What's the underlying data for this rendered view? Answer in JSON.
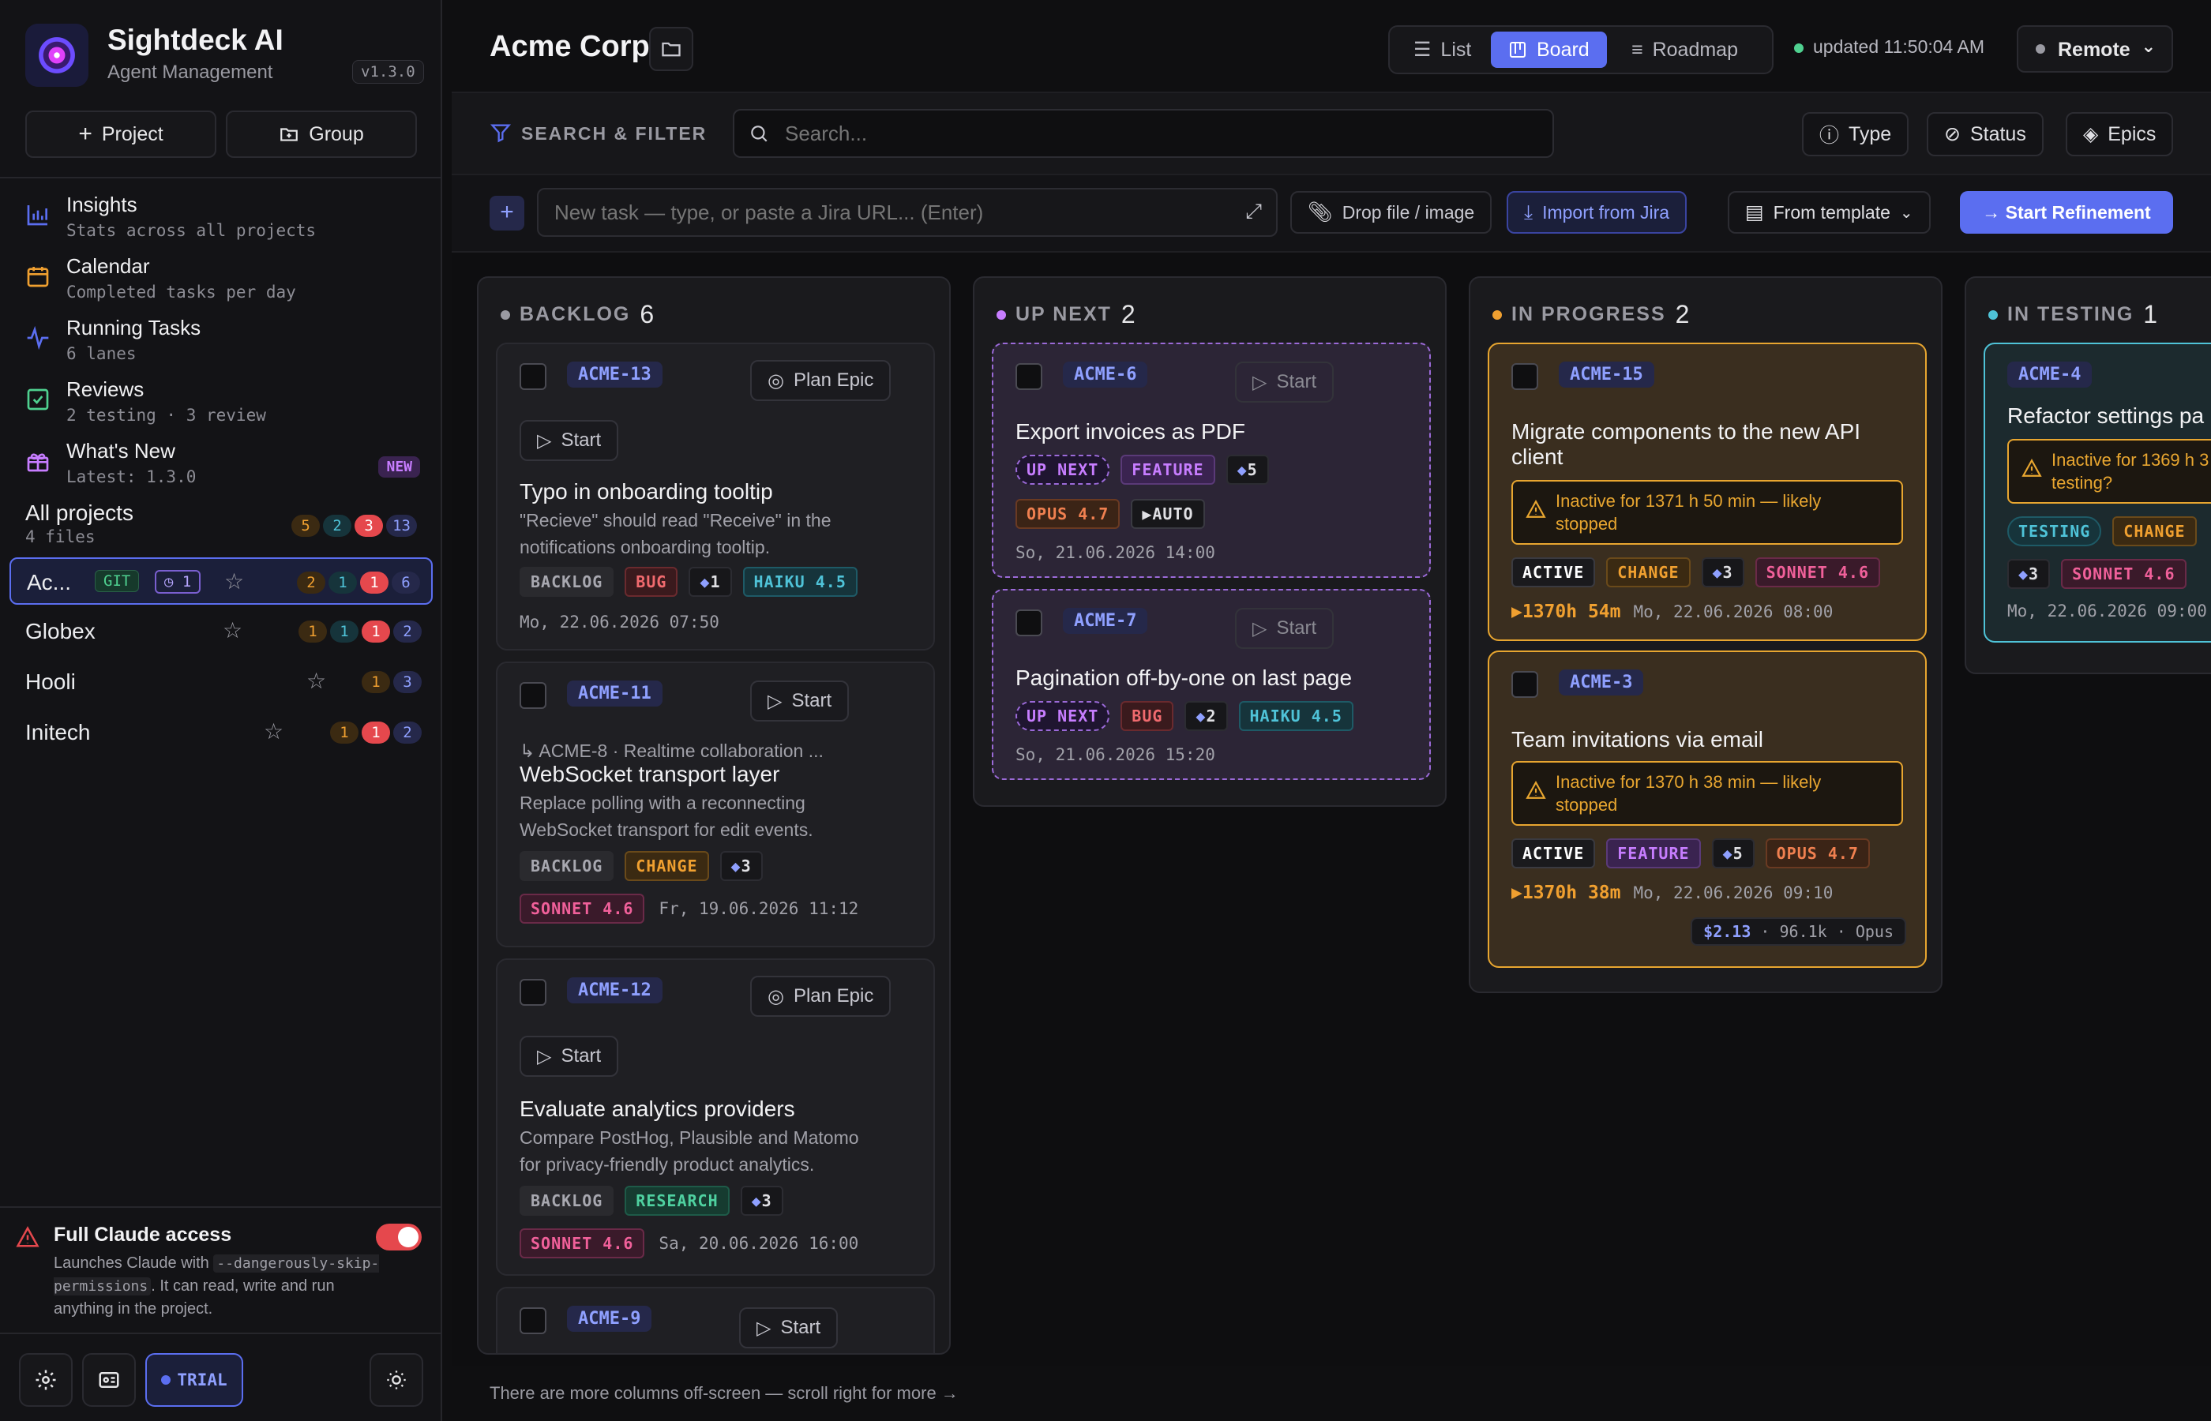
{
  "app": {
    "name": "Sightdeck AI",
    "subtitle": "Agent Management",
    "version": "v1.3.0"
  },
  "sidebar": {
    "add_project": "Project",
    "add_group": "Group",
    "nav": [
      {
        "title": "Insights",
        "sub": "Stats across all projects",
        "icon": "bar-chart-icon"
      },
      {
        "title": "Calendar",
        "sub": "Completed tasks per day",
        "icon": "calendar-icon"
      },
      {
        "title": "Running Tasks",
        "sub": "6 lanes",
        "icon": "activity-icon"
      },
      {
        "title": "Reviews",
        "sub": "2 testing · 3 review",
        "icon": "check-square-icon"
      },
      {
        "title": "What's New",
        "sub": "Latest: 1.3.0",
        "icon": "gift-icon",
        "badge": "NEW"
      }
    ],
    "all_projects": {
      "title": "All projects",
      "sub": "4 files",
      "counts": [
        "5",
        "2",
        "3",
        "13"
      ]
    },
    "projects": [
      {
        "name": "Ac...",
        "git": "GIT",
        "claude": "1",
        "counts": [
          "2",
          "1",
          "1",
          "6"
        ]
      },
      {
        "name": "Globex",
        "counts": [
          "1",
          "1",
          "1",
          "2"
        ]
      },
      {
        "name": "Hooli",
        "counts": [
          "1",
          "3"
        ]
      },
      {
        "name": "Initech",
        "counts": [
          "1",
          "1",
          "2"
        ]
      }
    ],
    "warning": {
      "title": "Full Claude access",
      "text_pre": "Launches Claude with ",
      "code": "--dangerously-skip-permissions",
      "text_post": ". It can read, write and run anything in the project."
    },
    "trial": "TRIAL"
  },
  "header": {
    "title": "Acme Corp",
    "views": [
      "List",
      "Board",
      "Roadmap"
    ],
    "active_view": "Board",
    "updated": "updated 11:50:04 AM",
    "remote": "Remote"
  },
  "filter": {
    "label": "SEARCH & FILTER",
    "search_placeholder": "Search...",
    "chips": [
      "Type",
      "Status",
      "Epics"
    ]
  },
  "task_input": {
    "placeholder": "New task — type, or paste a Jira URL... (Enter)",
    "drop": "Drop file / image",
    "import": "Import from Jira",
    "template": "From template",
    "refine": "→ Start Refinement"
  },
  "board": {
    "columns": [
      {
        "title": "BACKLOG",
        "count": "6",
        "color": "#9a9aa2"
      },
      {
        "title": "UP NEXT",
        "count": "2",
        "color": "#c77dff"
      },
      {
        "title": "IN PROGRESS",
        "count": "2",
        "color": "#f0a030"
      },
      {
        "title": "IN TESTING",
        "count": "1",
        "color": "#4fc3d8"
      }
    ],
    "backlog": [
      {
        "key": "ACME-13",
        "action": "Plan Epic",
        "start": "Start",
        "title": "Typo in onboarding tooltip",
        "desc1": "\"Recieve\" should read \"Receive\" in the",
        "desc2": "notifications onboarding tooltip.",
        "status": "BACKLOG",
        "type": "BUG",
        "points": "1",
        "model": "HAIKU 4.5",
        "date": "Mo, 22.06.2026 07:50"
      },
      {
        "key": "ACME-11",
        "start": "Start",
        "parent": "ACME-8 · Realtime collaboration ...",
        "title": "WebSocket transport layer",
        "desc1": "Replace polling with a reconnecting",
        "desc2": "WebSocket transport for edit events.",
        "status": "BACKLOG",
        "type": "CHANGE",
        "points": "3",
        "model": "SONNET 4.6",
        "date": "Fr, 19.06.2026 11:12"
      },
      {
        "key": "ACME-12",
        "action": "Plan Epic",
        "start": "Start",
        "title": "Evaluate analytics providers",
        "desc1": "Compare PostHog, Plausible and Matomo",
        "desc2": "for privacy-friendly product analytics.",
        "status": "BACKLOG",
        "type": "RESEARCH",
        "points": "3",
        "model": "SONNET 4.6",
        "date": "Sa, 20.06.2026 16:00"
      },
      {
        "key": "ACME-9",
        "start": "Start"
      }
    ],
    "upnext": [
      {
        "key": "ACME-6",
        "start": "Start",
        "title": "Export invoices as PDF",
        "status": "UP NEXT",
        "type": "FEATURE",
        "points": "5",
        "model": "OPUS 4.7",
        "auto": "AUTO",
        "date": "So, 21.06.2026 14:00"
      },
      {
        "key": "ACME-7",
        "start": "Start",
        "title": "Pagination off-by-one on last page",
        "status": "UP NEXT",
        "type": "BUG",
        "points": "2",
        "model": "HAIKU 4.5",
        "date": "So, 21.06.2026 15:20"
      }
    ],
    "inprogress": [
      {
        "key": "ACME-15",
        "title1": "Migrate components to the new API",
        "title2": "client",
        "inactive1": "Inactive for 1371 h 50 min — likely",
        "inactive2": "stopped",
        "status": "ACTIVE",
        "type": "CHANGE",
        "points": "3",
        "model": "SONNET 4.6",
        "timer": "1370h 54m",
        "date": "Mo, 22.06.2026 08:00"
      },
      {
        "key": "ACME-3",
        "title1": "Team invitations via email",
        "inactive1": "Inactive for 1370 h 38 min — likely",
        "inactive2": "stopped",
        "status": "ACTIVE",
        "type": "FEATURE",
        "points": "5",
        "model": "OPUS 4.7",
        "timer": "1370h 38m",
        "date": "Mo, 22.06.2026 09:10",
        "cost": "$2.13",
        "tokens": "· 96.1k · Opus"
      }
    ],
    "intesting": [
      {
        "key": "ACME-4",
        "title": "Refactor settings pa",
        "inactive1": "Inactive for 1369 h 3",
        "inactive2": "testing?",
        "status": "TESTING",
        "type": "CHANGE",
        "points": "3",
        "model": "SONNET 4.6",
        "date": "Mo, 22.06.2026 09:00"
      }
    ]
  },
  "footer_hint": "There are more columns off-screen — scroll right for more →"
}
